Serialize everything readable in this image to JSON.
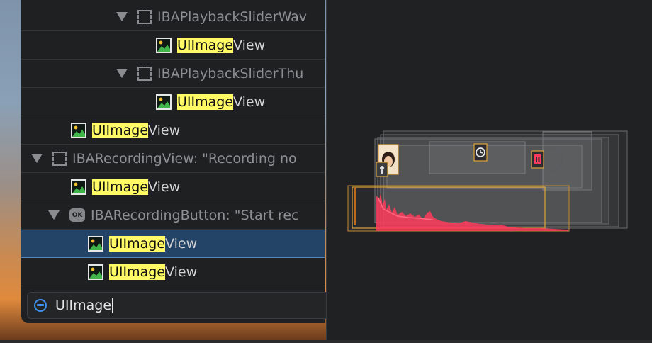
{
  "outline": {
    "rows": [
      {
        "name": "IBAPlaybackSliderWav",
        "highlight": "",
        "rest": ""
      },
      {
        "highlight": "UIImage",
        "rest": "View"
      },
      {
        "name": "IBAPlaybackSliderThu",
        "highlight": "",
        "rest": ""
      },
      {
        "highlight": "UIImage",
        "rest": "View"
      },
      {
        "highlight": "UIImage",
        "rest": "View"
      },
      {
        "name": "IBARecordingView: \"Recording no",
        "highlight": "",
        "rest": ""
      },
      {
        "highlight": "UIImage",
        "rest": "View"
      },
      {
        "name": "IBARecordingButton: \"Start rec",
        "highlight": "",
        "rest": "",
        "badge": "OK"
      },
      {
        "highlight": "UIImage",
        "rest": "View"
      },
      {
        "highlight": "UIImage",
        "rest": "View"
      }
    ]
  },
  "search": {
    "value": "UIImage"
  },
  "colors": {
    "selection": "#234466",
    "highlight": "#fffa66",
    "accent": "#3e90f0",
    "waveform": "#ff3b5c",
    "frame_outline": "#e0a43a"
  }
}
